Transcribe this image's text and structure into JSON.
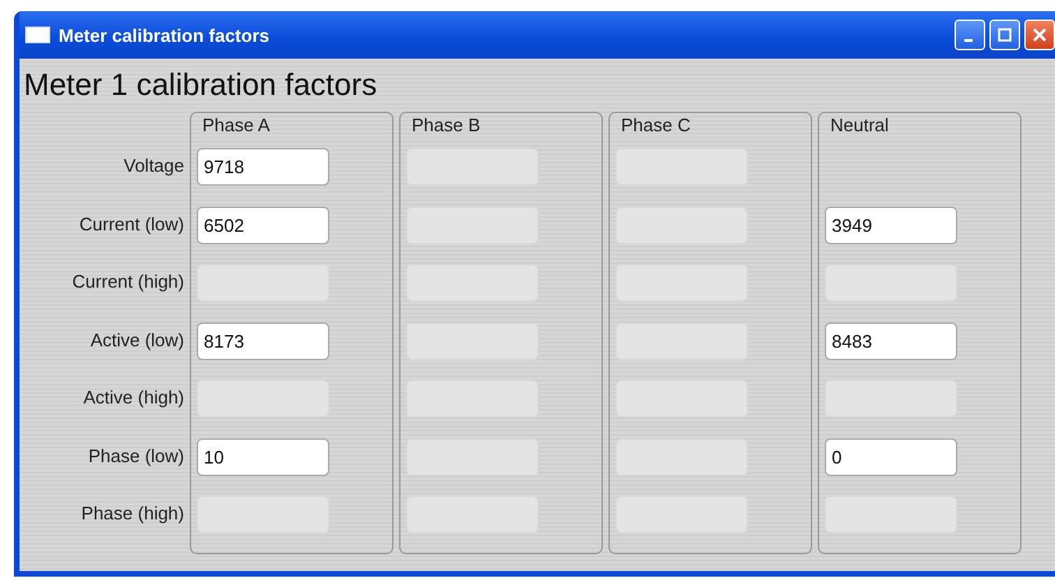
{
  "window": {
    "title": "Meter calibration factors"
  },
  "heading": "Meter 1 calibration factors",
  "row_labels": [
    "Voltage",
    "Current (low)",
    "Current (high)",
    "Active (low)",
    "Active (high)",
    "Phase (low)",
    "Phase (high)"
  ],
  "groups": [
    {
      "title": "Phase A",
      "cells": [
        {
          "kind": "field",
          "disabled": false,
          "value": "9718"
        },
        {
          "kind": "field",
          "disabled": false,
          "value": "6502"
        },
        {
          "kind": "field",
          "disabled": true
        },
        {
          "kind": "field",
          "disabled": false,
          "value": "8173"
        },
        {
          "kind": "field",
          "disabled": true
        },
        {
          "kind": "field",
          "disabled": false,
          "value": "10"
        },
        {
          "kind": "field",
          "disabled": true
        }
      ]
    },
    {
      "title": "Phase B",
      "cells": [
        {
          "kind": "field",
          "disabled": true
        },
        {
          "kind": "field",
          "disabled": true
        },
        {
          "kind": "field",
          "disabled": true
        },
        {
          "kind": "field",
          "disabled": true
        },
        {
          "kind": "field",
          "disabled": true
        },
        {
          "kind": "field",
          "disabled": true
        },
        {
          "kind": "field",
          "disabled": true
        }
      ]
    },
    {
      "title": "Phase C",
      "cells": [
        {
          "kind": "field",
          "disabled": true
        },
        {
          "kind": "field",
          "disabled": true
        },
        {
          "kind": "field",
          "disabled": true
        },
        {
          "kind": "field",
          "disabled": true
        },
        {
          "kind": "field",
          "disabled": true
        },
        {
          "kind": "field",
          "disabled": true
        },
        {
          "kind": "field",
          "disabled": true
        }
      ]
    },
    {
      "title": "Neutral",
      "cells": [
        {
          "kind": "blank"
        },
        {
          "kind": "field",
          "disabled": false,
          "value": "3949"
        },
        {
          "kind": "field",
          "disabled": true
        },
        {
          "kind": "field",
          "disabled": false,
          "value": "8483"
        },
        {
          "kind": "field",
          "disabled": true
        },
        {
          "kind": "field",
          "disabled": false,
          "value": "0"
        },
        {
          "kind": "field",
          "disabled": true
        }
      ]
    }
  ]
}
